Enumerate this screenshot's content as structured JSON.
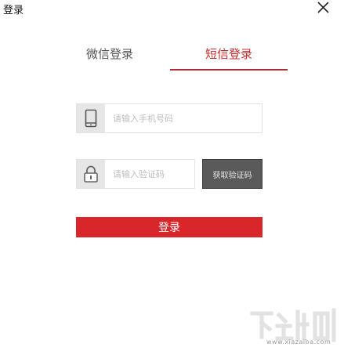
{
  "window": {
    "title": "登录",
    "close_icon": "close-icon"
  },
  "tabs": [
    {
      "label": "微信登录",
      "active": false
    },
    {
      "label": "短信登录",
      "active": true
    }
  ],
  "phone_field": {
    "icon": "phone-icon",
    "placeholder": "请输入手机号码",
    "value": ""
  },
  "code_field": {
    "icon": "lock-icon",
    "placeholder": "请输入验证码",
    "value": ""
  },
  "get_code_button": {
    "label": "获取验证码"
  },
  "login_button": {
    "label": "登录"
  },
  "watermark": {
    "url": "www.xiazaiba.com",
    "icon": "xiazaiba-logo-watermark"
  },
  "colors": {
    "accent": "#d9262b",
    "tab_active": "#cc2a2a",
    "underline": "#a53131",
    "button_dark": "#5a5a5a",
    "icon_bg": "#e6e6e6"
  }
}
